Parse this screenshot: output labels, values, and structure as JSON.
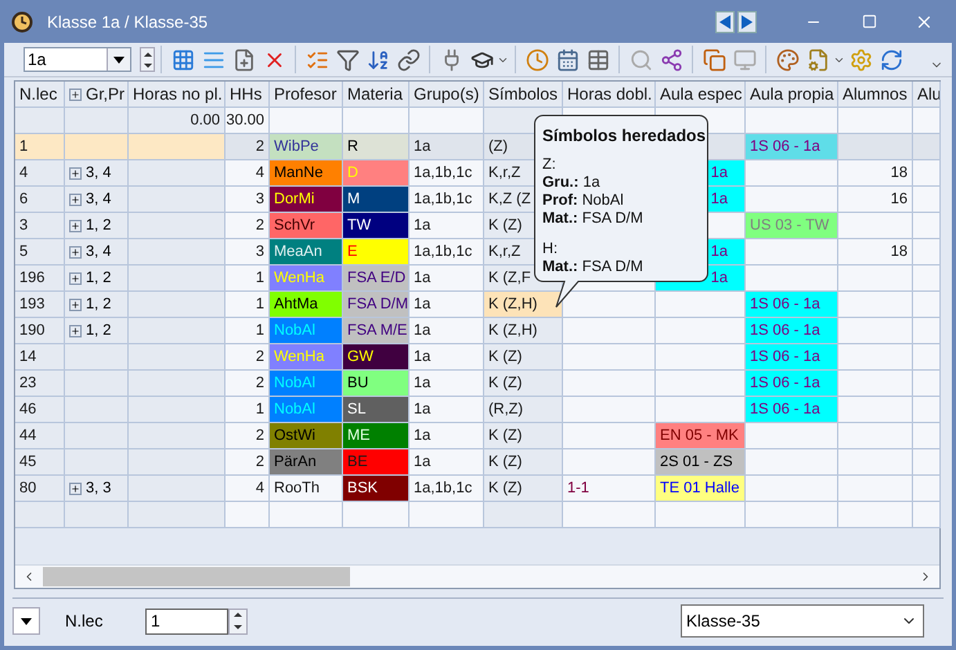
{
  "window": {
    "title": "Klasse 1a / Klasse-35"
  },
  "toolbar": {
    "class_select": {
      "value": "1a"
    }
  },
  "table": {
    "columns": [
      "N.lec",
      "Gr,Pr",
      "Horas no pl.",
      "HHs",
      "Profesor",
      "Materia",
      "Grupo(s)",
      "Símbolos",
      "Horas dobl.",
      "Aula espec",
      "Aula propia",
      "Alumnos",
      "Alu"
    ],
    "summary": {
      "unplanned_hours": "0.00",
      "hhs": "30.00"
    },
    "rows": [
      {
        "selected": true,
        "n_lec": "1",
        "hhs": "2",
        "teacher": {
          "text": "WibPe",
          "color": "#c4e0c0"
        },
        "subject": {
          "text": "R",
          "color": "#dde2d6"
        },
        "classes": "1a",
        "symbols": {
          "text": "(Z)",
          "focused": false
        },
        "own_room": {
          "text": "1S 06 - 1a",
          "color": "#5fdde8"
        }
      },
      {
        "selected": false,
        "n_lec": "4",
        "groups": "3, 4",
        "hhs": "4",
        "teacher": {
          "text": "ManNe",
          "color": "#ff8000"
        },
        "subject": {
          "text": "D",
          "color": "#ff8080"
        },
        "classes": "1a,1b,1c",
        "symbols": {
          "text": "K,r,Z",
          "focused": false
        },
        "special_room": {
          "text": "1a",
          "color": "#00ffff",
          "partly_hidden": true
        },
        "students": "18"
      },
      {
        "selected": false,
        "n_lec": "6",
        "groups": "3, 4",
        "hhs": "3",
        "teacher": {
          "text": "DorMi",
          "color": "#800040"
        },
        "subject": {
          "text": "M",
          "color": "#004080"
        },
        "classes": "1a,1b,1c",
        "symbols": {
          "text": "K,Z (Z",
          "focused": false
        },
        "special_room": {
          "text": "1a",
          "color": "#00ffff",
          "partly_hidden": true
        },
        "students": "16"
      },
      {
        "selected": false,
        "n_lec": "3",
        "groups": "1, 2",
        "hhs": "2",
        "teacher": {
          "text": "SchVr",
          "color": "#ff6666"
        },
        "subject": {
          "text": "TW",
          "color": "#000080"
        },
        "classes": "1a",
        "symbols": {
          "text": "K (Z)",
          "focused": false
        },
        "own_room": {
          "text": "US 03 - TW",
          "color": "#80ff80"
        }
      },
      {
        "selected": false,
        "n_lec": "5",
        "groups": "3, 4",
        "hhs": "3",
        "teacher": {
          "text": "MeaAn",
          "color": "#008080"
        },
        "subject": {
          "text": "E",
          "color": "#ffff00"
        },
        "classes": "1a,1b,1c",
        "symbols": {
          "text": "K,r,Z",
          "focused": false
        },
        "special_room": {
          "text": "1a",
          "color": "#00ffff",
          "partly_hidden": true
        },
        "students": "18"
      },
      {
        "selected": false,
        "n_lec": "196",
        "groups": "1, 2",
        "hhs": "1",
        "teacher": {
          "text": "WenHa",
          "color": "#8080ff"
        },
        "subject": {
          "text": "FSA E/D",
          "color": "#c0c0c0"
        },
        "classes": "1a",
        "symbols": {
          "text": "K (Z,F",
          "focused": false
        },
        "special_room": {
          "text": "1a",
          "color": "#00ffff",
          "partly_hidden": true
        }
      },
      {
        "selected": false,
        "n_lec": "193",
        "groups": "1, 2",
        "hhs": "1",
        "teacher": {
          "text": "AhtMa",
          "color": "#80ff00"
        },
        "subject": {
          "text": "FSA D/M",
          "color": "#c0c0c0"
        },
        "classes": "1a",
        "symbols": {
          "text": "K (Z,H)",
          "focused": true
        },
        "own_room": {
          "text": "1S 06 - 1a",
          "color": "#00ffff"
        }
      },
      {
        "selected": false,
        "n_lec": "190",
        "groups": "1, 2",
        "hhs": "1",
        "teacher": {
          "text": "NobAl",
          "color": "#0080ff"
        },
        "subject": {
          "text": "FSA M/E",
          "color": "#c0c0c0"
        },
        "classes": "1a",
        "symbols": {
          "text": "K (Z,H)",
          "focused": false
        },
        "own_room": {
          "text": "1S 06 - 1a",
          "color": "#00ffff"
        }
      },
      {
        "selected": false,
        "n_lec": "14",
        "hhs": "2",
        "teacher": {
          "text": "WenHa",
          "color": "#8080ff"
        },
        "subject": {
          "text": "GW",
          "color": "#400040"
        },
        "classes": "1a",
        "symbols": {
          "text": "K (Z)",
          "focused": false
        },
        "own_room": {
          "text": "1S 06 - 1a",
          "color": "#00ffff"
        }
      },
      {
        "selected": false,
        "n_lec": "23",
        "hhs": "2",
        "teacher": {
          "text": "NobAl",
          "color": "#0080ff"
        },
        "subject": {
          "text": "BU",
          "color": "#80ff80"
        },
        "classes": "1a",
        "symbols": {
          "text": "K (Z)",
          "focused": false
        },
        "own_room": {
          "text": "1S 06 - 1a",
          "color": "#00ffff"
        }
      },
      {
        "selected": false,
        "n_lec": "46",
        "hhs": "1",
        "teacher": {
          "text": "NobAl",
          "color": "#0080ff"
        },
        "subject": {
          "text": "SL",
          "color": "#606060"
        },
        "classes": "1a",
        "symbols": {
          "text": "(R,Z)",
          "focused": false
        },
        "own_room": {
          "text": "1S 06 - 1a",
          "color": "#00ffff"
        }
      },
      {
        "selected": false,
        "n_lec": "44",
        "hhs": "2",
        "teacher": {
          "text": "OstWi",
          "color": "#808000"
        },
        "subject": {
          "text": "ME",
          "color": "#008000"
        },
        "classes": "1a",
        "symbols": {
          "text": "K (Z)",
          "focused": false
        },
        "special_room": {
          "text": "EN 05 - MK",
          "color": "#ff8080",
          "partly_hidden": false
        }
      },
      {
        "selected": false,
        "n_lec": "45",
        "hhs": "2",
        "teacher": {
          "text": "PärAn",
          "color": "#808080"
        },
        "subject": {
          "text": "BE",
          "color": "#ff0000"
        },
        "classes": "1a",
        "symbols": {
          "text": "K (Z)",
          "focused": false
        },
        "special_room": {
          "text": "2S 01 - ZS",
          "color": "#c0c0c0",
          "partly_hidden": false
        }
      },
      {
        "selected": false,
        "n_lec": "80",
        "groups": "3, 3",
        "hhs": "4",
        "teacher": {
          "text": "RooTh"
        },
        "subject": {
          "text": "BSK",
          "color": "#800000"
        },
        "classes": "1a,1b,1c",
        "symbols": {
          "text": "K (Z)",
          "focused": false
        },
        "double_hours": "1-1",
        "special_room": {
          "text": "TE 01 Halle",
          "color": "#ffff80",
          "partly_hidden": false
        }
      }
    ]
  },
  "tooltip": {
    "title": "Símbolos heredados",
    "sections": [
      {
        "lines": [
          "Z:",
          "**Gru.:** 1a",
          "**Prof:** NobAl",
          "**Mat.:** FSA D/M"
        ]
      },
      {
        "lines": [
          "H:",
          "**Mat.:** FSA D/M"
        ]
      }
    ]
  },
  "footer": {
    "field_label": "N.lec",
    "field_value": "1",
    "class_select": {
      "value": "Klasse-35"
    }
  }
}
